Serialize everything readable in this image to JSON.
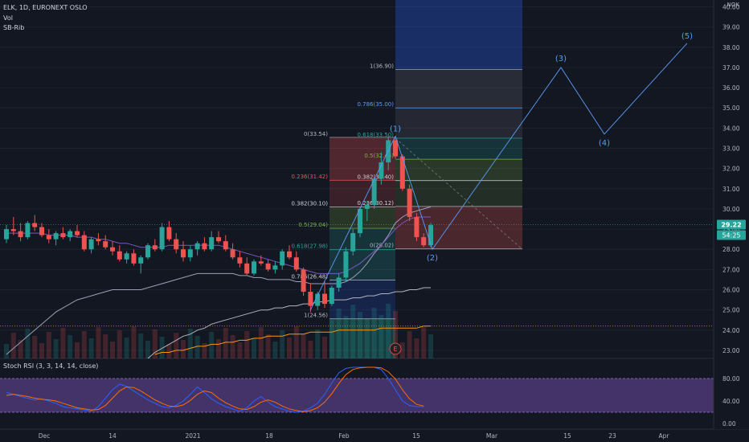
{
  "header": {
    "symbol_line": "ELK, 1D, EURONEXT OSLO",
    "indicator_1": "Vol",
    "indicator_2": "SB-Rib",
    "currency": "NOK",
    "stoch_label": "Stoch RSI (3, 3, 14, 14, close)"
  },
  "chart_data": {
    "type": "candlestick",
    "price_axis": {
      "ticks": [
        "40.00",
        "39.00",
        "38.00",
        "37.00",
        "36.00",
        "35.00",
        "34.00",
        "33.00",
        "32.00",
        "31.00",
        "30.00",
        "29.00",
        "28.00",
        "27.00",
        "26.00",
        "25.00",
        "24.00",
        "23.00"
      ],
      "range": [
        22.6,
        40.1
      ],
      "current_price": "29.22",
      "volume_badge": "54:25"
    },
    "stoch_axis": {
      "ticks": [
        "80.00",
        "40.00",
        "0.00"
      ],
      "range": [
        -10,
        110
      ],
      "band": [
        20,
        80
      ]
    },
    "time_axis": [
      "Dec",
      "14",
      "2021",
      "18",
      "Feb",
      "15",
      "Mar",
      "15",
      "23",
      "Apr"
    ],
    "candles": [
      [
        28.5,
        29.2,
        28.3,
        29.0
      ],
      [
        29.0,
        29.6,
        28.7,
        28.9
      ],
      [
        28.9,
        29.3,
        28.4,
        28.6
      ],
      [
        28.6,
        29.4,
        28.5,
        29.3
      ],
      [
        29.3,
        29.7,
        28.9,
        29.1
      ],
      [
        29.1,
        29.3,
        28.6,
        28.7
      ],
      [
        28.7,
        29.0,
        28.3,
        28.5
      ],
      [
        28.5,
        28.9,
        28.2,
        28.8
      ],
      [
        28.8,
        29.1,
        28.5,
        28.6
      ],
      [
        28.6,
        29.0,
        28.4,
        28.9
      ],
      [
        28.9,
        29.2,
        28.6,
        28.7
      ],
      [
        28.7,
        28.9,
        27.9,
        28.0
      ],
      [
        28.0,
        28.6,
        27.8,
        28.5
      ],
      [
        28.5,
        28.8,
        28.2,
        28.4
      ],
      [
        28.4,
        28.7,
        28.0,
        28.1
      ],
      [
        28.1,
        28.4,
        27.7,
        27.9
      ],
      [
        27.9,
        28.2,
        27.4,
        27.5
      ],
      [
        27.5,
        27.9,
        27.3,
        27.8
      ],
      [
        27.8,
        28.0,
        27.2,
        27.3
      ],
      [
        27.3,
        27.7,
        26.8,
        27.6
      ],
      [
        27.6,
        28.3,
        27.5,
        28.2
      ],
      [
        28.2,
        28.5,
        27.9,
        28.0
      ],
      [
        28.0,
        29.3,
        27.9,
        29.1
      ],
      [
        29.1,
        29.4,
        28.4,
        28.5
      ],
      [
        28.5,
        28.8,
        27.8,
        28.0
      ],
      [
        28.0,
        28.4,
        27.4,
        27.6
      ],
      [
        27.6,
        28.2,
        27.4,
        28.0
      ],
      [
        28.0,
        28.4,
        27.7,
        28.3
      ],
      [
        28.3,
        28.6,
        27.9,
        28.0
      ],
      [
        28.0,
        28.9,
        27.9,
        28.6
      ],
      [
        28.6,
        28.9,
        28.3,
        28.4
      ],
      [
        28.4,
        28.7,
        27.9,
        28.0
      ],
      [
        28.0,
        28.3,
        27.5,
        27.6
      ],
      [
        27.6,
        27.9,
        27.1,
        27.3
      ],
      [
        27.3,
        27.6,
        26.7,
        26.8
      ],
      [
        26.8,
        27.5,
        26.7,
        27.4
      ],
      [
        27.4,
        27.7,
        27.2,
        27.3
      ],
      [
        27.3,
        27.5,
        26.9,
        27.0
      ],
      [
        27.0,
        27.4,
        26.8,
        27.2
      ],
      [
        27.2,
        28.0,
        27.0,
        27.9
      ],
      [
        27.9,
        28.2,
        27.5,
        27.6
      ],
      [
        27.6,
        27.9,
        26.9,
        27.0
      ],
      [
        27.0,
        27.1,
        25.7,
        25.9
      ],
      [
        25.9,
        26.3,
        24.9,
        25.2
      ],
      [
        25.2,
        25.9,
        25.0,
        25.8
      ],
      [
        25.8,
        26.4,
        25.1,
        25.3
      ],
      [
        25.3,
        26.2,
        25.2,
        26.1
      ],
      [
        26.1,
        26.8,
        25.9,
        26.6
      ],
      [
        26.6,
        28.1,
        26.4,
        27.9
      ],
      [
        27.9,
        29.0,
        27.7,
        28.8
      ],
      [
        28.8,
        30.1,
        28.6,
        30.0
      ],
      [
        30.0,
        30.4,
        29.4,
        30.2
      ],
      [
        30.2,
        31.7,
        30.0,
        31.5
      ],
      [
        31.5,
        32.8,
        31.2,
        32.3
      ],
      [
        32.3,
        33.6,
        31.9,
        33.4
      ],
      [
        33.4,
        33.5,
        32.5,
        32.6
      ],
      [
        32.6,
        32.7,
        30.9,
        31.0
      ],
      [
        31.0,
        31.2,
        29.4,
        29.6
      ],
      [
        29.6,
        29.8,
        28.4,
        28.6
      ],
      [
        28.6,
        28.8,
        28.1,
        28.2
      ],
      [
        28.2,
        29.3,
        28.1,
        29.2
      ]
    ],
    "ma_fast": [
      28.8,
      28.8,
      28.8,
      28.8,
      28.8,
      28.8,
      28.7,
      28.7,
      28.7,
      28.7,
      28.6,
      28.6,
      28.6,
      28.5,
      28.5,
      28.4,
      28.3,
      28.3,
      28.2,
      28.1,
      28.1,
      28.1,
      28.1,
      28.2,
      28.2,
      28.2,
      28.2,
      28.2,
      28.2,
      28.2,
      28.2,
      28.1,
      28.0,
      27.9,
      27.8,
      27.7,
      27.6,
      27.5,
      27.4,
      27.3,
      27.2,
      27.1,
      27.0,
      26.9,
      26.8,
      26.8,
      26.8,
      26.8,
      26.9,
      27.1,
      27.3,
      27.6,
      27.9,
      28.2,
      28.6,
      29.0,
      29.3,
      29.5,
      29.6,
      29.6,
      29.6
    ],
    "ma_slow_1": [
      22.8,
      23.1,
      23.4,
      23.7,
      24.0,
      24.3,
      24.6,
      24.9,
      25.1,
      25.3,
      25.5,
      25.6,
      25.7,
      25.8,
      25.9,
      26.0,
      26.0,
      26.0,
      26.0,
      26.0,
      26.1,
      26.2,
      26.3,
      26.4,
      26.5,
      26.6,
      26.7,
      26.8,
      26.8,
      26.8,
      26.8,
      26.8,
      26.8,
      26.7,
      26.7,
      26.6,
      26.6,
      26.5,
      26.5,
      26.5,
      26.5,
      26.4,
      26.4,
      26.3,
      26.3,
      26.3,
      26.3,
      26.3,
      26.4,
      26.6,
      26.9,
      27.3,
      27.8,
      28.2,
      28.7,
      29.3,
      29.6,
      29.8,
      29.9,
      30.0,
      30.1
    ],
    "ma_slow_2": [
      null,
      null,
      null,
      null,
      null,
      null,
      null,
      null,
      null,
      null,
      null,
      null,
      null,
      null,
      null,
      null,
      null,
      null,
      null,
      null,
      22.6,
      22.9,
      23.1,
      23.3,
      23.5,
      23.7,
      23.8,
      24.0,
      24.1,
      24.3,
      24.4,
      24.5,
      24.6,
      24.7,
      24.8,
      24.9,
      25.0,
      25.0,
      25.1,
      25.1,
      25.2,
      25.2,
      25.3,
      25.3,
      25.4,
      25.4,
      25.5,
      25.5,
      25.5,
      25.6,
      25.6,
      25.7,
      25.7,
      25.8,
      25.8,
      25.9,
      25.9,
      26.0,
      26.0,
      26.1,
      26.1
    ],
    "ma_slow_3": [
      null,
      null,
      null,
      null,
      null,
      null,
      null,
      null,
      null,
      null,
      null,
      null,
      null,
      null,
      null,
      null,
      null,
      null,
      null,
      null,
      null,
      22.8,
      22.9,
      22.9,
      23.0,
      23.0,
      23.1,
      23.2,
      23.2,
      23.3,
      23.3,
      23.4,
      23.4,
      23.5,
      23.5,
      23.6,
      23.6,
      23.7,
      23.7,
      23.7,
      23.8,
      23.8,
      23.8,
      23.9,
      23.9,
      23.9,
      23.9,
      24.0,
      24.0,
      24.0,
      24.0,
      24.0,
      24.0,
      24.1,
      24.1,
      24.1,
      24.1,
      24.1,
      24.1,
      24.2,
      24.2
    ],
    "stoch_k": [
      55,
      52,
      48,
      45,
      42,
      44,
      40,
      36,
      30,
      28,
      26,
      24,
      22,
      30,
      45,
      60,
      70,
      66,
      58,
      50,
      42,
      36,
      30,
      28,
      32,
      40,
      52,
      65,
      55,
      44,
      36,
      30,
      26,
      22,
      28,
      40,
      48,
      38,
      30,
      26,
      22,
      20,
      22,
      28,
      36,
      52,
      72,
      90,
      98,
      100,
      100,
      100,
      100,
      96,
      80,
      60,
      40,
      32,
      30,
      30
    ],
    "stoch_d": [
      50,
      52,
      50,
      48,
      45,
      43,
      42,
      40,
      36,
      32,
      28,
      26,
      24,
      25,
      32,
      45,
      58,
      65,
      64,
      58,
      50,
      42,
      36,
      31,
      30,
      33,
      41,
      52,
      58,
      55,
      45,
      37,
      31,
      26,
      25,
      30,
      38,
      42,
      38,
      31,
      26,
      23,
      21,
      23,
      28,
      38,
      53,
      71,
      87,
      96,
      99,
      100,
      100,
      99,
      92,
      79,
      60,
      44,
      34,
      31
    ]
  },
  "fib_upper": {
    "levels": [
      {
        "label": "1(36.90)",
        "price": 36.9,
        "color": "#b2b5be"
      },
      {
        "label": "0.786(35.00)",
        "price": 35.0,
        "color": "#5b9cf6"
      },
      {
        "label": "0.618(33.50)",
        "price": 33.5,
        "color": "#26a69a"
      },
      {
        "label": "0.5(32.46)",
        "price": 32.46,
        "color": "#7cb342"
      },
      {
        "label": "0.382(31.40)",
        "price": 31.4,
        "color": "#d1d4dc"
      },
      {
        "label": "0.236(30.12)",
        "price": 30.12,
        "color": "#d1d4dc"
      },
      {
        "label": "0(28.02)",
        "price": 28.02,
        "color": "#b2b5be"
      }
    ]
  },
  "fib_left": {
    "levels": [
      {
        "label": "0(33.54)",
        "price": 33.54,
        "color": "#b2b5be"
      },
      {
        "label": "0.236(31.42)",
        "price": 31.42,
        "color": "#ef5350"
      },
      {
        "label": "0.382(30.10)",
        "price": 30.1,
        "color": "#d1d4dc"
      },
      {
        "label": "0.5(29.04)",
        "price": 29.04,
        "color": "#7cb342"
      },
      {
        "label": "0.618(27.98)",
        "price": 27.98,
        "color": "#26a69a"
      },
      {
        "label": "0.786(26.48)",
        "price": 26.48,
        "color": "#d1d4dc"
      },
      {
        "label": "1(24.56)",
        "price": 24.56,
        "color": "#b2b5be"
      }
    ]
  },
  "waves": [
    "(1)",
    "(2)",
    "(3)",
    "(4)",
    "(5)"
  ],
  "earnings_marker": "E"
}
